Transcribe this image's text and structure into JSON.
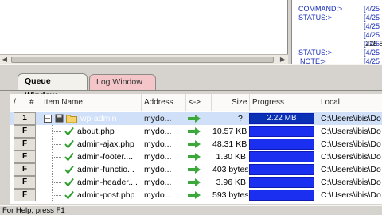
{
  "message_log": {
    "lines": [
      {
        "label": "COMMAND:>",
        "value": "[4/25"
      },
      {
        "label": "STATUS:>",
        "value": "[4/25"
      },
      {
        "label": "",
        "value": "[4/25"
      },
      {
        "label": "",
        "value": "[4/25"
      },
      {
        "label": "",
        "value": "[4/25"
      },
      {
        "label": "",
        "value": "226 8"
      },
      {
        "label": "STATUS:>",
        "value": "[4/25"
      },
      {
        "label": "NOTE:>",
        "value": "[4/25"
      }
    ]
  },
  "tabs": {
    "queue": "Queue Window",
    "log": "Log Window"
  },
  "columns": {
    "sort": "/",
    "num": "#",
    "item_name": "Item Name",
    "address": "Address",
    "direction": "<->",
    "size": "Size",
    "progress": "Progress",
    "local": "Local"
  },
  "rows": [
    {
      "status": "1",
      "name": "wp-admin",
      "address": "mydo...",
      "size": "?",
      "progress_text": "2.22 MB",
      "local": "C:\\Users\\ibis\\Do"
    },
    {
      "status": "F",
      "name": "about.php",
      "address": "mydo...",
      "size": "10.57 KB",
      "progress_text": "",
      "local": "C:\\Users\\ibis\\Do"
    },
    {
      "status": "F",
      "name": "admin-ajax.php",
      "address": "mydo...",
      "size": "48.31 KB",
      "progress_text": "",
      "local": "C:\\Users\\ibis\\Do"
    },
    {
      "status": "F",
      "name": "admin-footer....",
      "address": "mydo...",
      "size": "1.30 KB",
      "progress_text": "",
      "local": "C:\\Users\\ibis\\Do"
    },
    {
      "status": "F",
      "name": "admin-functio...",
      "address": "mydo...",
      "size": "403 bytes",
      "progress_text": "",
      "local": "C:\\Users\\ibis\\Do"
    },
    {
      "status": "F",
      "name": "admin-header....",
      "address": "mydo...",
      "size": "3.96 KB",
      "progress_text": "",
      "local": "C:\\Users\\ibis\\Do"
    },
    {
      "status": "F",
      "name": "admin-post.php",
      "address": "mydo...",
      "size": "593 bytes",
      "progress_text": "",
      "local": "C:\\Users\\ibis\\Do"
    }
  ],
  "status_bar": "For Help, press F1",
  "colors": {
    "progress_fill": "#1b2ff0",
    "progress_first": "#0a30b5",
    "log_tab": "#f4c6c9",
    "arrow": "#3ca83c"
  }
}
